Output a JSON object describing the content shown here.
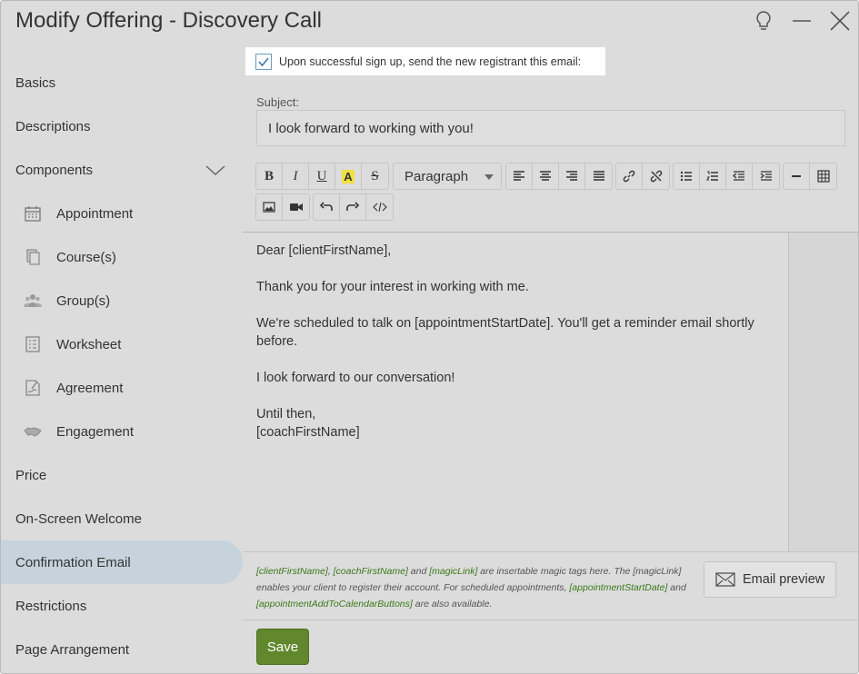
{
  "window": {
    "title": "Modify Offering - Discovery Call",
    "icons": [
      "lightbulb-icon",
      "minimize-icon",
      "close-icon"
    ]
  },
  "sidebar": {
    "items": [
      {
        "label": "Basics"
      },
      {
        "label": "Descriptions"
      },
      {
        "label": "Components",
        "expanded": true
      },
      {
        "label": "Appointment",
        "icon": "calendar-icon"
      },
      {
        "label": "Course(s)",
        "icon": "copy-icon"
      },
      {
        "label": "Group(s)",
        "icon": "group-icon"
      },
      {
        "label": "Worksheet",
        "icon": "checklist-icon"
      },
      {
        "label": "Agreement",
        "icon": "document-sign-icon"
      },
      {
        "label": "Engagement",
        "icon": "handshake-icon"
      },
      {
        "label": "Price"
      },
      {
        "label": "On-Screen Welcome"
      },
      {
        "label": "Confirmation Email",
        "active": true
      },
      {
        "label": "Restrictions"
      },
      {
        "label": "Page Arrangement"
      }
    ]
  },
  "main": {
    "send_email_label": "Upon successful sign up, send the new registrant this email:",
    "send_email_checked": true,
    "subject_label": "Subject:",
    "subject_value": "I look forward to working with you!",
    "toolbar": {
      "bold": "B",
      "italic": "I",
      "underline": "U",
      "highlight": "A",
      "strike": "S",
      "format_select": "Paragraph"
    },
    "email_body": [
      "Dear [clientFirstName],",
      "Thank you for your interest in working with me.",
      "We're scheduled to talk on [appointmentStartDate].  You'll get a reminder email shortly before.",
      "I look forward to our conversation!",
      "Until then,",
      "[coachFirstName]"
    ],
    "note": {
      "tag_client": "[clientFirstName]",
      "sep1": ", ",
      "tag_coach": "[coachFirstName]",
      "text_and": " and ",
      "tag_magic": "[magicLink]",
      "text_mid": " are insertable magic tags here. The [magicLink] enables your client to register their account. For scheduled appointments, ",
      "tag_start": "[appointmentStartDate]",
      "text_and2": " and ",
      "tag_calendar": "[appointmentAddToCalendarButtons]",
      "text_end": " are also available."
    },
    "preview_label": "Email preview",
    "save_label": "Save"
  },
  "colors": {
    "save_button": "#62882e",
    "active_nav": "#c6d3dc",
    "magic_tag": "#3a7a1a"
  }
}
